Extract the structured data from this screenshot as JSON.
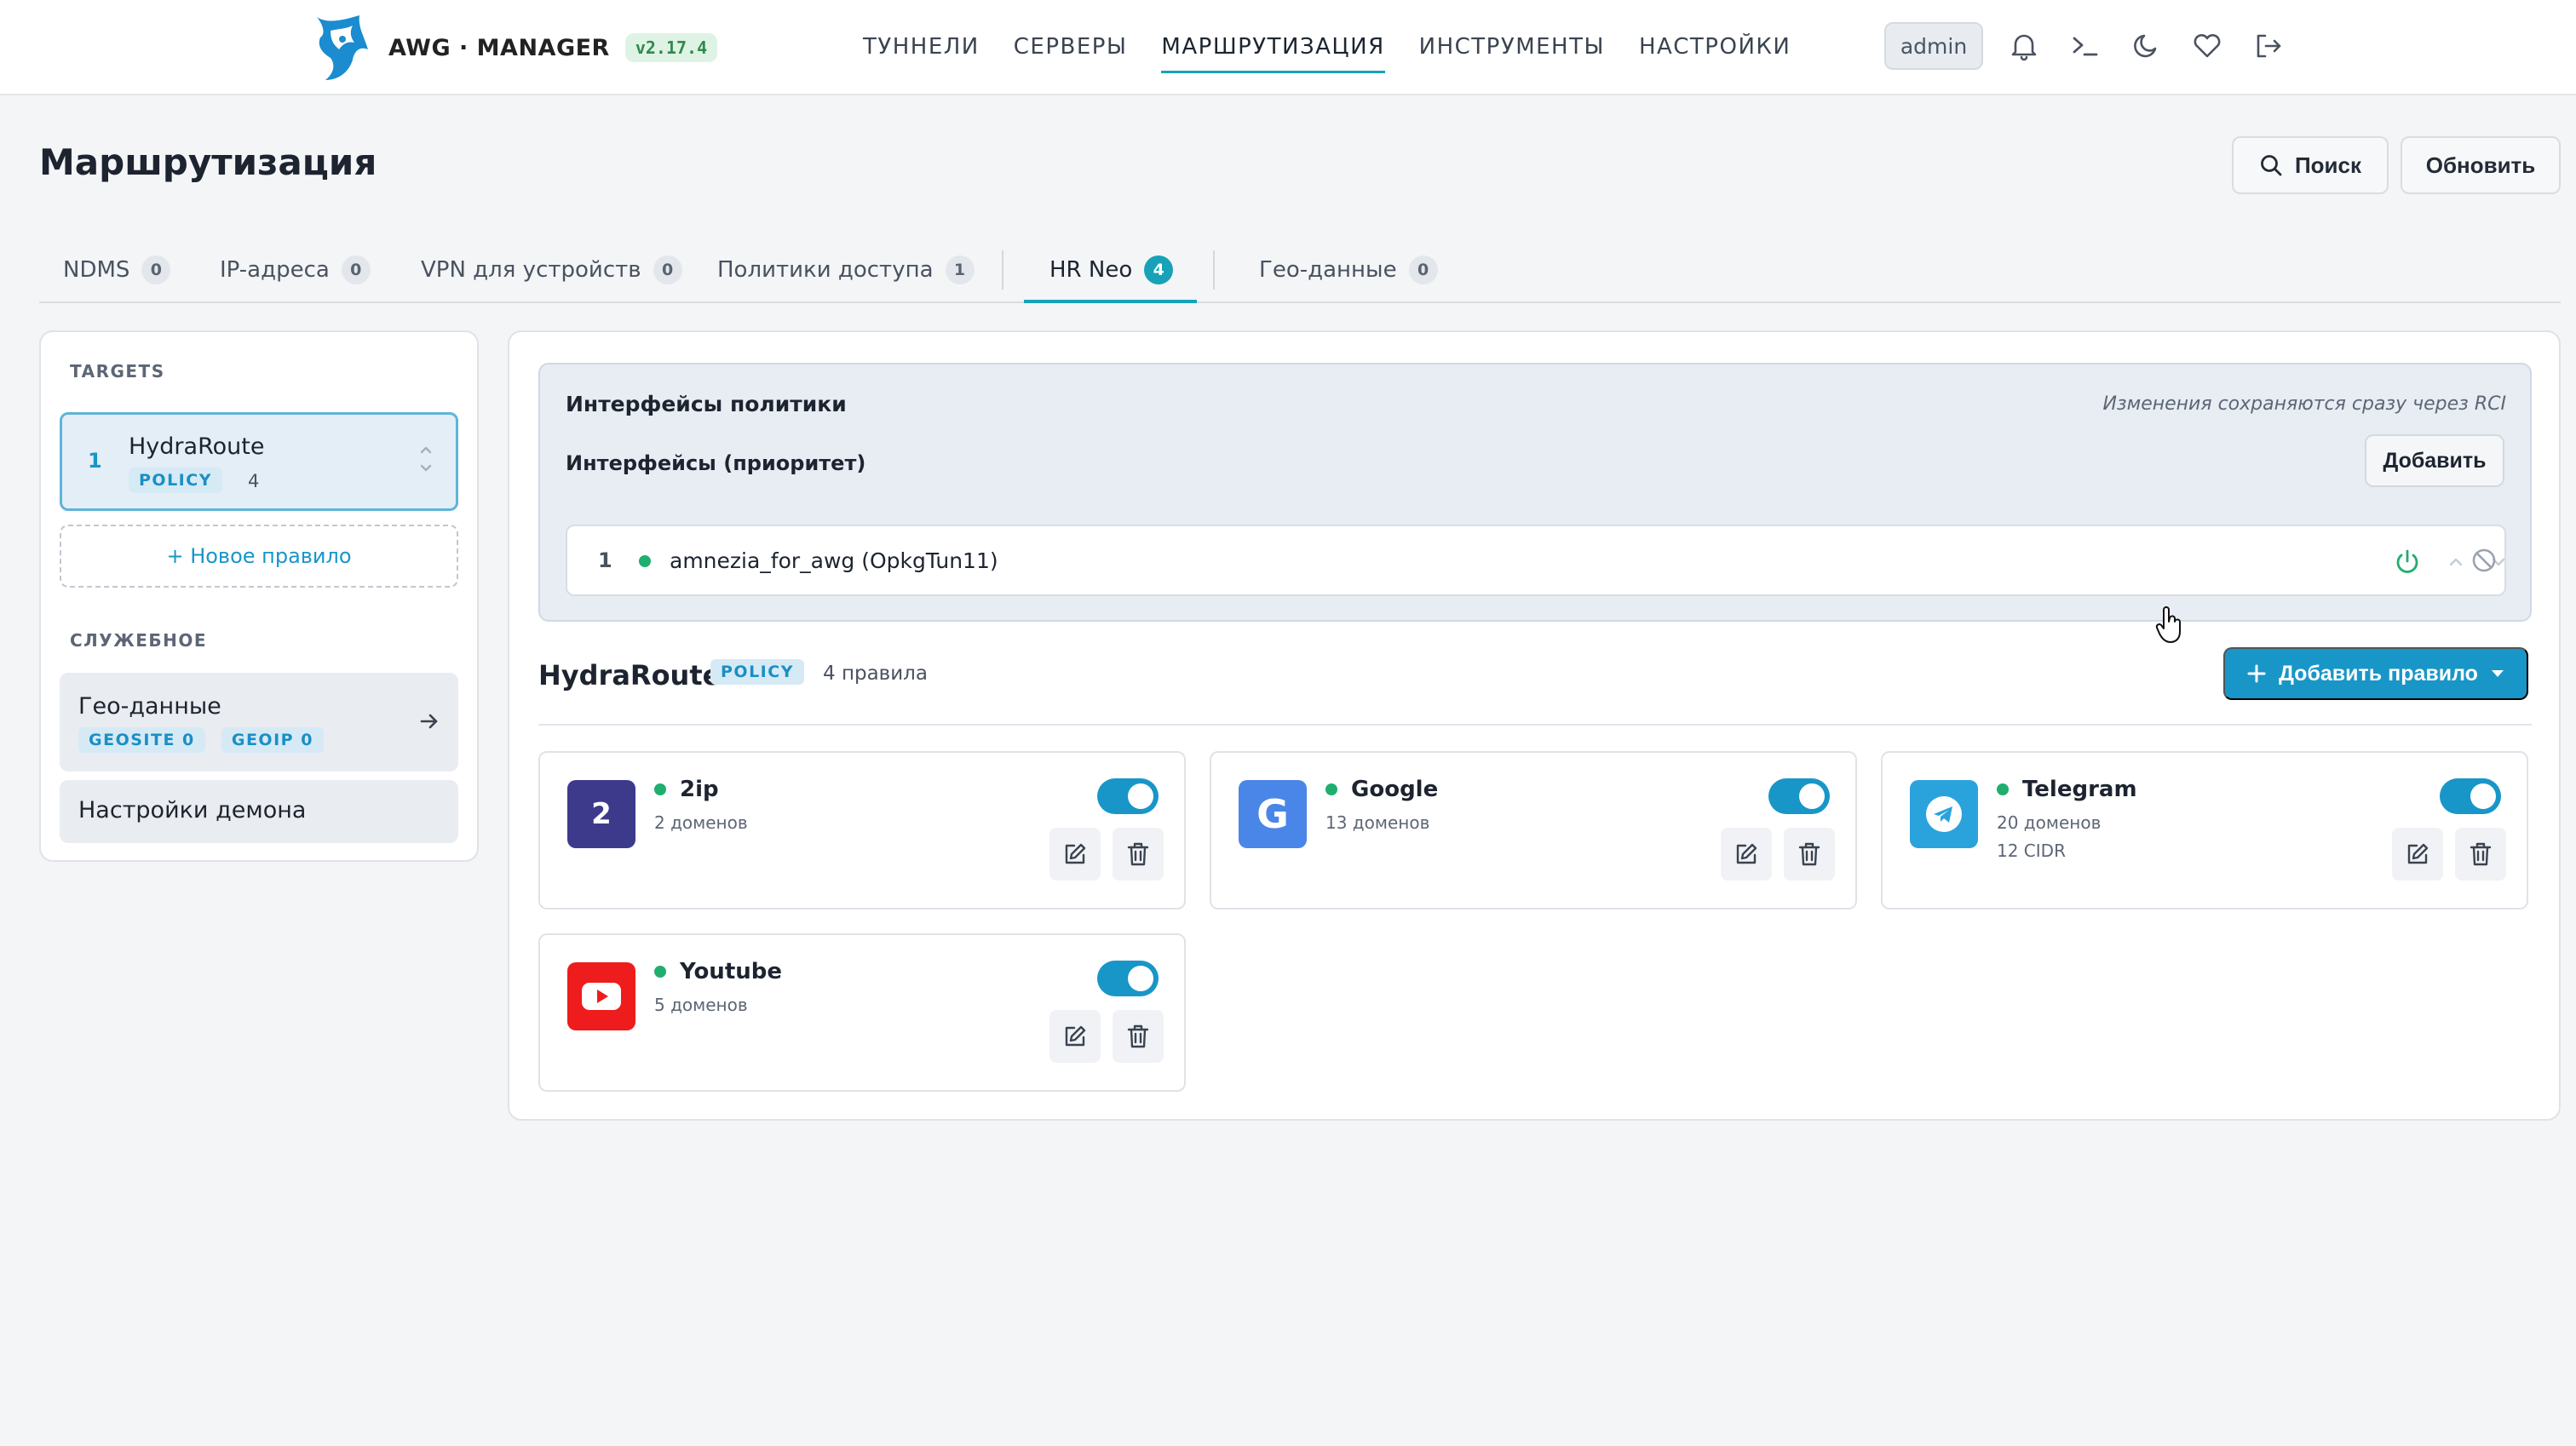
{
  "app": {
    "name": "AWG · MANAGER",
    "version": "v2.17.4",
    "user": "admin",
    "accent": "#1996c8"
  },
  "nav": {
    "items": [
      {
        "label": "ТУННЕЛИ"
      },
      {
        "label": "СЕРВЕРЫ"
      },
      {
        "label": "МАРШРУТИЗАЦИЯ",
        "active": true
      },
      {
        "label": "ИНСТРУМЕНТЫ"
      },
      {
        "label": "НАСТРОЙКИ"
      }
    ],
    "icons": [
      "bell-icon",
      "terminal-icon",
      "moon-icon",
      "heart-icon",
      "logout-icon"
    ]
  },
  "page": {
    "title": "Маршрутизация",
    "search_label": "Поиск",
    "refresh_label": "Обновить"
  },
  "tabs": [
    {
      "label": "NDMS",
      "count": "0"
    },
    {
      "label": "IP-адреса",
      "count": "0"
    },
    {
      "label": "VPN для устройств",
      "count": "0"
    },
    {
      "label": "Политики доступа",
      "count": "1"
    },
    {
      "label": "HR Neo",
      "count": "4",
      "active": true
    },
    {
      "label": "Гео-данные",
      "count": "0"
    }
  ],
  "sidebar": {
    "targets_heading": "TARGETS",
    "target": {
      "num": "1",
      "name": "HydraRoute",
      "badge": "POLICY",
      "count": "4"
    },
    "new_rule_label": "+ Новое правило",
    "service_heading": "СЛУЖЕБНОЕ",
    "geo": {
      "title": "Гео-данные",
      "chips": [
        "GEOSITE 0",
        "GEOIP 0"
      ]
    },
    "daemon_label": "Настройки демона"
  },
  "policy_interfaces": {
    "title": "Интерфейсы политики",
    "note": "Изменения сохраняются сразу через RCI",
    "subtitle": "Интерфейсы (приоритет)",
    "add_label": "Добавить",
    "rows": [
      {
        "num": "1",
        "name": "amnezia_for_awg (OpkgTun11)",
        "status_color": "#1fae6e"
      }
    ]
  },
  "rules_section": {
    "title": "HydraRoute",
    "badge": "POLICY",
    "count_label": "4 правила",
    "add_label": "Добавить правило"
  },
  "rules": [
    {
      "name": "2ip",
      "meta": [
        "2 доменов"
      ],
      "enabled": true,
      "icon": "2ip-icon",
      "icon_text": "2",
      "icon_color": "#3d3a8c"
    },
    {
      "name": "Google",
      "meta": [
        "13 доменов"
      ],
      "enabled": true,
      "icon": "google-icon",
      "icon_text": "G",
      "icon_color": "#4a86e8"
    },
    {
      "name": "Telegram",
      "meta": [
        "20 доменов",
        "12 CIDR"
      ],
      "enabled": true,
      "icon": "telegram-icon",
      "icon_text": "",
      "icon_color": "#2aa3dd"
    },
    {
      "name": "Youtube",
      "meta": [
        "5 доменов"
      ],
      "enabled": true,
      "icon": "youtube-icon",
      "icon_text": "",
      "icon_color": "#ee1c1c"
    }
  ]
}
